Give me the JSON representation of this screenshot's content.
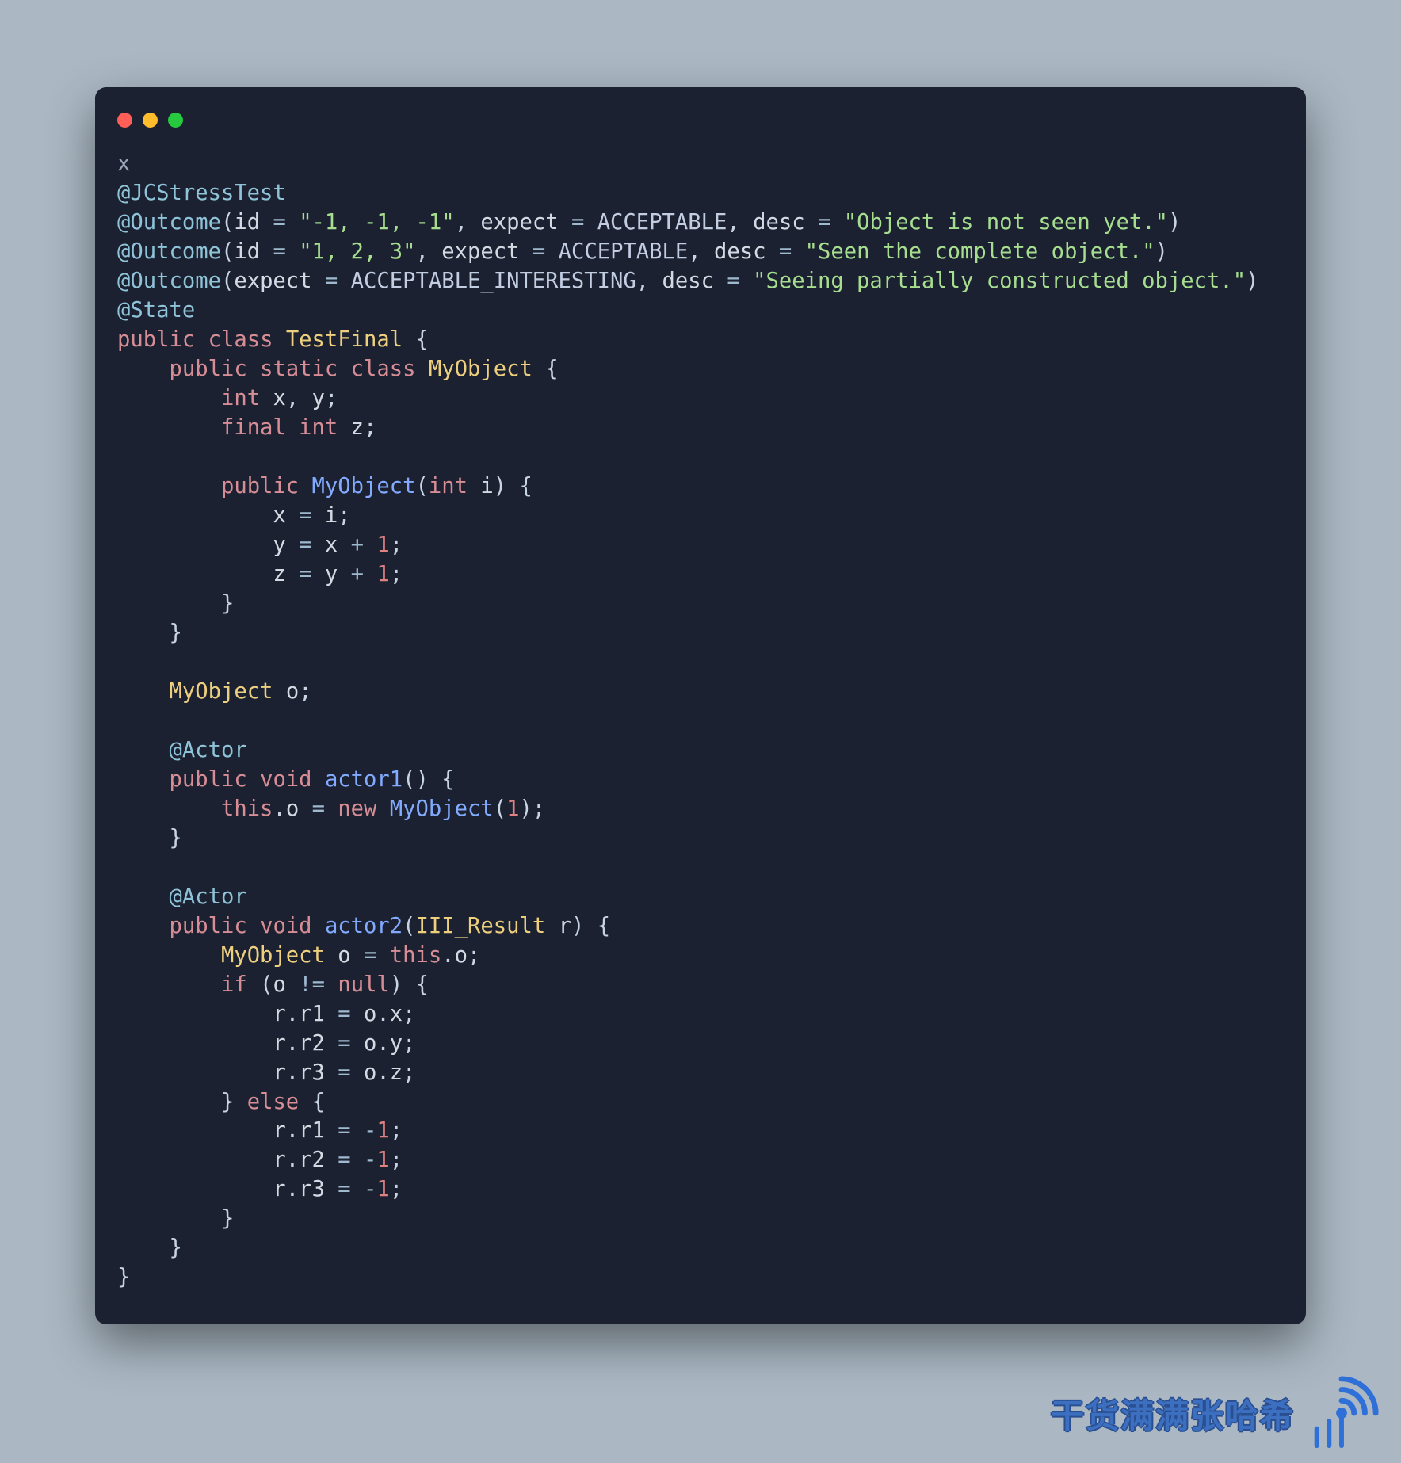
{
  "windowDots": [
    "red",
    "yellow",
    "green"
  ],
  "code": {
    "l1": "x",
    "l2": {
      "anno": "@JCStressTest"
    },
    "l3": {
      "anno": "@Outcome",
      "open": "(",
      "p1k": "id",
      "eq1": " = ",
      "p1v": "\"-1, -1, -1\"",
      "c1": ", ",
      "p2k": "expect",
      "eq2": " = ",
      "p2v": "ACCEPTABLE",
      "c2": ", ",
      "p3k": "desc",
      "eq3": " = ",
      "p3v": "\"Object is not seen yet.\"",
      "close": ")"
    },
    "l4": {
      "anno": "@Outcome",
      "open": "(",
      "p1k": "id",
      "eq1": " = ",
      "p1v": "\"1, 2, 3\"",
      "c1": ", ",
      "p2k": "expect",
      "eq2": " = ",
      "p2v": "ACCEPTABLE",
      "c2": ", ",
      "p3k": "desc",
      "eq3": " = ",
      "p3v": "\"Seen the complete object.\"",
      "close": ")"
    },
    "l5": {
      "anno": "@Outcome",
      "open": "(",
      "p1k": "expect",
      "eq1": " = ",
      "p1v": "ACCEPTABLE_INTERESTING",
      "c1": ", ",
      "p2k": "desc",
      "eq2": " = ",
      "p2v": "\"Seeing partially constructed object.\"",
      "close": ")"
    },
    "l6": {
      "anno": "@State"
    },
    "l7": {
      "kw1": "public",
      "sp1": " ",
      "kw2": "class",
      "sp2": " ",
      "type": "TestFinal",
      "sp3": " ",
      "brace": "{"
    },
    "l8": {
      "indent": "    ",
      "kw1": "public",
      "sp1": " ",
      "kw2": "static",
      "sp2": " ",
      "kw3": "class",
      "sp3": " ",
      "type": "MyObject",
      "sp4": " ",
      "brace": "{"
    },
    "l9": {
      "indent": "        ",
      "kw": "int",
      "sp": " ",
      "v1": "x",
      "c": ", ",
      "v2": "y",
      "semi": ";"
    },
    "l10": {
      "indent": "        ",
      "kw1": "final",
      "sp1": " ",
      "kw2": "int",
      "sp2": " ",
      "v": "z",
      "semi": ";"
    },
    "l12": {
      "indent": "        ",
      "kw": "public",
      "sp": " ",
      "fn": "MyObject",
      "open": "(",
      "pt": "int",
      "psp": " ",
      "pn": "i",
      "close": ")",
      "sp2": " ",
      "brace": "{"
    },
    "l13": {
      "indent": "            ",
      "lhs": "x",
      "sp1": " ",
      "op": "=",
      "sp2": " ",
      "rhs": "i",
      "semi": ";"
    },
    "l14": {
      "indent": "            ",
      "lhs": "y",
      "sp1": " ",
      "op": "=",
      "sp2": " ",
      "a": "x",
      "sp3": " ",
      "plus": "+",
      "sp4": " ",
      "n": "1",
      "semi": ";"
    },
    "l15": {
      "indent": "            ",
      "lhs": "z",
      "sp1": " ",
      "op": "=",
      "sp2": " ",
      "a": "y",
      "sp3": " ",
      "plus": "+",
      "sp4": " ",
      "n": "1",
      "semi": ";"
    },
    "l16": {
      "indent": "        ",
      "brace": "}"
    },
    "l17": {
      "indent": "    ",
      "brace": "}"
    },
    "l19": {
      "indent": "    ",
      "type": "MyObject",
      "sp": " ",
      "v": "o",
      "semi": ";"
    },
    "l21": {
      "indent": "    ",
      "anno": "@Actor"
    },
    "l22": {
      "indent": "    ",
      "kw1": "public",
      "sp1": " ",
      "kw2": "void",
      "sp2": " ",
      "fn": "actor1",
      "open": "(",
      "close": ")",
      "sp3": " ",
      "brace": "{"
    },
    "l23": {
      "indent": "        ",
      "this": "this",
      "dot": ".",
      "f": "o",
      "sp1": " ",
      "op": "=",
      "sp2": " ",
      "new": "new",
      "sp3": " ",
      "ctor": "MyObject",
      "open": "(",
      "arg": "1",
      "close": ")",
      "semi": ";"
    },
    "l24": {
      "indent": "    ",
      "brace": "}"
    },
    "l26": {
      "indent": "    ",
      "anno": "@Actor"
    },
    "l27": {
      "indent": "    ",
      "kw1": "public",
      "sp1": " ",
      "kw2": "void",
      "sp2": " ",
      "fn": "actor2",
      "open": "(",
      "pt": "III_Result",
      "psp": " ",
      "pn": "r",
      "close": ")",
      "sp3": " ",
      "brace": "{"
    },
    "l28": {
      "indent": "        ",
      "type": "MyObject",
      "sp1": " ",
      "v": "o",
      "sp2": " ",
      "op": "=",
      "sp3": " ",
      "this": "this",
      "dot": ".",
      "f": "o",
      "semi": ";"
    },
    "l29": {
      "indent": "        ",
      "kw": "if",
      "sp": " ",
      "open": "(",
      "v": "o",
      "sp1": " ",
      "op": "!=",
      "sp2": " ",
      "null": "null",
      "close": ")",
      "sp3": " ",
      "brace": "{"
    },
    "l30": {
      "indent": "            ",
      "r": "r",
      "d1": ".",
      "f1": "r1",
      "sp1": " ",
      "op": "=",
      "sp2": " ",
      "o": "o",
      "d2": ".",
      "f2": "x",
      "semi": ";"
    },
    "l31": {
      "indent": "            ",
      "r": "r",
      "d1": ".",
      "f1": "r2",
      "sp1": " ",
      "op": "=",
      "sp2": " ",
      "o": "o",
      "d2": ".",
      "f2": "y",
      "semi": ";"
    },
    "l32": {
      "indent": "            ",
      "r": "r",
      "d1": ".",
      "f1": "r3",
      "sp1": " ",
      "op": "=",
      "sp2": " ",
      "o": "o",
      "d2": ".",
      "f2": "z",
      "semi": ";"
    },
    "l33": {
      "indent": "        ",
      "brace": "}",
      "sp": " ",
      "kw": "else",
      "sp2": " ",
      "brace2": "{"
    },
    "l34": {
      "indent": "            ",
      "r": "r",
      "d1": ".",
      "f1": "r1",
      "sp1": " ",
      "op": "=",
      "sp2": " ",
      "neg": "-",
      "n": "1",
      "semi": ";"
    },
    "l35": {
      "indent": "            ",
      "r": "r",
      "d1": ".",
      "f1": "r2",
      "sp1": " ",
      "op": "=",
      "sp2": " ",
      "neg": "-",
      "n": "1",
      "semi": ";"
    },
    "l36": {
      "indent": "            ",
      "r": "r",
      "d1": ".",
      "f1": "r3",
      "sp1": " ",
      "op": "=",
      "sp2": " ",
      "neg": "-",
      "n": "1",
      "semi": ";"
    },
    "l37": {
      "indent": "        ",
      "brace": "}"
    },
    "l38": {
      "indent": "    ",
      "brace": "}"
    },
    "l39": {
      "brace": "}"
    }
  },
  "watermark": {
    "text": "干货满满张哈希"
  }
}
